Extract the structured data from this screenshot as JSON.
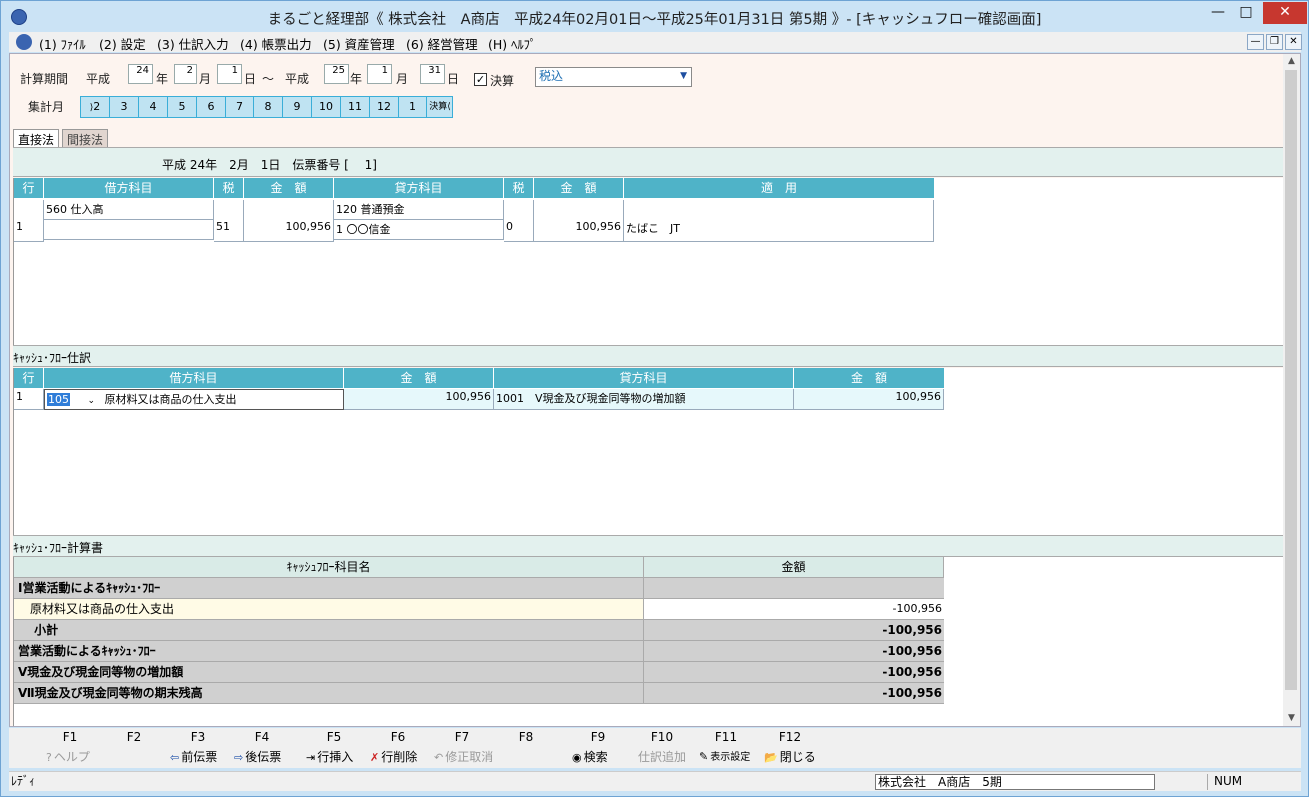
{
  "window": {
    "title": "まるごと経理部《 株式会社　A商店　平成24年02月01日～平成25年01月31日 第5期 》- [キャッシュフロー確認画面]"
  },
  "menu": [
    "(1) ﾌｧｲﾙ",
    "(2) 設定",
    "(3) 仕訳入力",
    "(4) 帳票出力",
    "(5) 資産管理",
    "(6) 経営管理",
    "(H) ﾍﾙﾌﾟ"
  ],
  "period": {
    "label": "計算期間",
    "era1": "平成",
    "y1": "24",
    "u_year": "年",
    "m1": "2",
    "u_month": "月",
    "d1": "1",
    "u_day": "日",
    "tilde": "～",
    "era2": "平成",
    "y2": "25",
    "m2": "1",
    "d2": "31",
    "kessan_label": "決算",
    "tax_option": "税込"
  },
  "months": {
    "label": "集計月",
    "items": [
      "2",
      "3",
      "4",
      "5",
      "6",
      "7",
      "8",
      "9",
      "10",
      "11",
      "12",
      "1",
      "決算"
    ]
  },
  "tabs": [
    "直接法",
    "間接法"
  ],
  "voucher": {
    "header": "平成 24年　2月　1日　伝票番号 [　 1]",
    "columns": [
      "行",
      "借方科目",
      "税",
      "金　額",
      "貸方科目",
      "税",
      "金　額",
      "適　用"
    ],
    "row": {
      "line": "1",
      "debit_account": "560 仕入高",
      "debit_tax": "51",
      "debit_amount": "100,956",
      "credit_account": "120 普通預金",
      "credit_sub": "1 〇〇信金",
      "credit_tax": "0",
      "credit_amount": "100,956",
      "memo": "たばこ　JT"
    }
  },
  "cf_journal": {
    "title": "ｷｬｯｼｭ･ﾌﾛｰ仕訳",
    "columns": [
      "行",
      "借方科目",
      "金　額",
      "貸方科目",
      "金　額"
    ],
    "row": {
      "line": "1",
      "debit_code": "105",
      "debit_name": "原材料又は商品の仕入支出",
      "debit_amount": "100,956",
      "credit": "1001　Ⅴ現金及び現金同等物の増加額",
      "credit_amount": "100,956"
    }
  },
  "cf_statement": {
    "title": "ｷｬｯｼｭ･ﾌﾛｰ計算書",
    "columns": [
      "ｷｬｯｼｭﾌﾛｰ科目名",
      "金額"
    ],
    "rows": [
      {
        "name": "Ⅰ営業活動によるｷｬｯｼｭ･ﾌﾛｰ",
        "amount": "",
        "style": "gray"
      },
      {
        "name": "　原材料又は商品の仕入支出",
        "amount": "-100,956",
        "style": "yel"
      },
      {
        "name": "　 小計",
        "amount": "-100,956",
        "style": "gray"
      },
      {
        "name": "営業活動によるｷｬｯｼｭ･ﾌﾛｰ",
        "amount": "-100,956",
        "style": "gray"
      },
      {
        "name": "Ⅴ現金及び現金同等物の増加額",
        "amount": "-100,956",
        "style": "gray"
      },
      {
        "name": "Ⅶ現金及び現金同等物の期末残高",
        "amount": "-100,956",
        "style": "gray"
      }
    ]
  },
  "fkeys": {
    "keys": [
      "F1",
      "F2",
      "F3",
      "F4",
      "F5",
      "F6",
      "F7",
      "F8",
      "F9",
      "F10",
      "F11",
      "F12"
    ],
    "actions": {
      "help": "ヘルプ",
      "prev": "前伝票",
      "next": "後伝票",
      "ins": "行挿入",
      "del": "行削除",
      "undo": "修正取消",
      "search": "検索",
      "add": "仕訳追加",
      "disp": "表示設定",
      "close": "閉じる"
    }
  },
  "status": {
    "left": "ﾚﾃﾞｨ",
    "company": "株式会社　A商店　5期",
    "num": "NUM"
  }
}
